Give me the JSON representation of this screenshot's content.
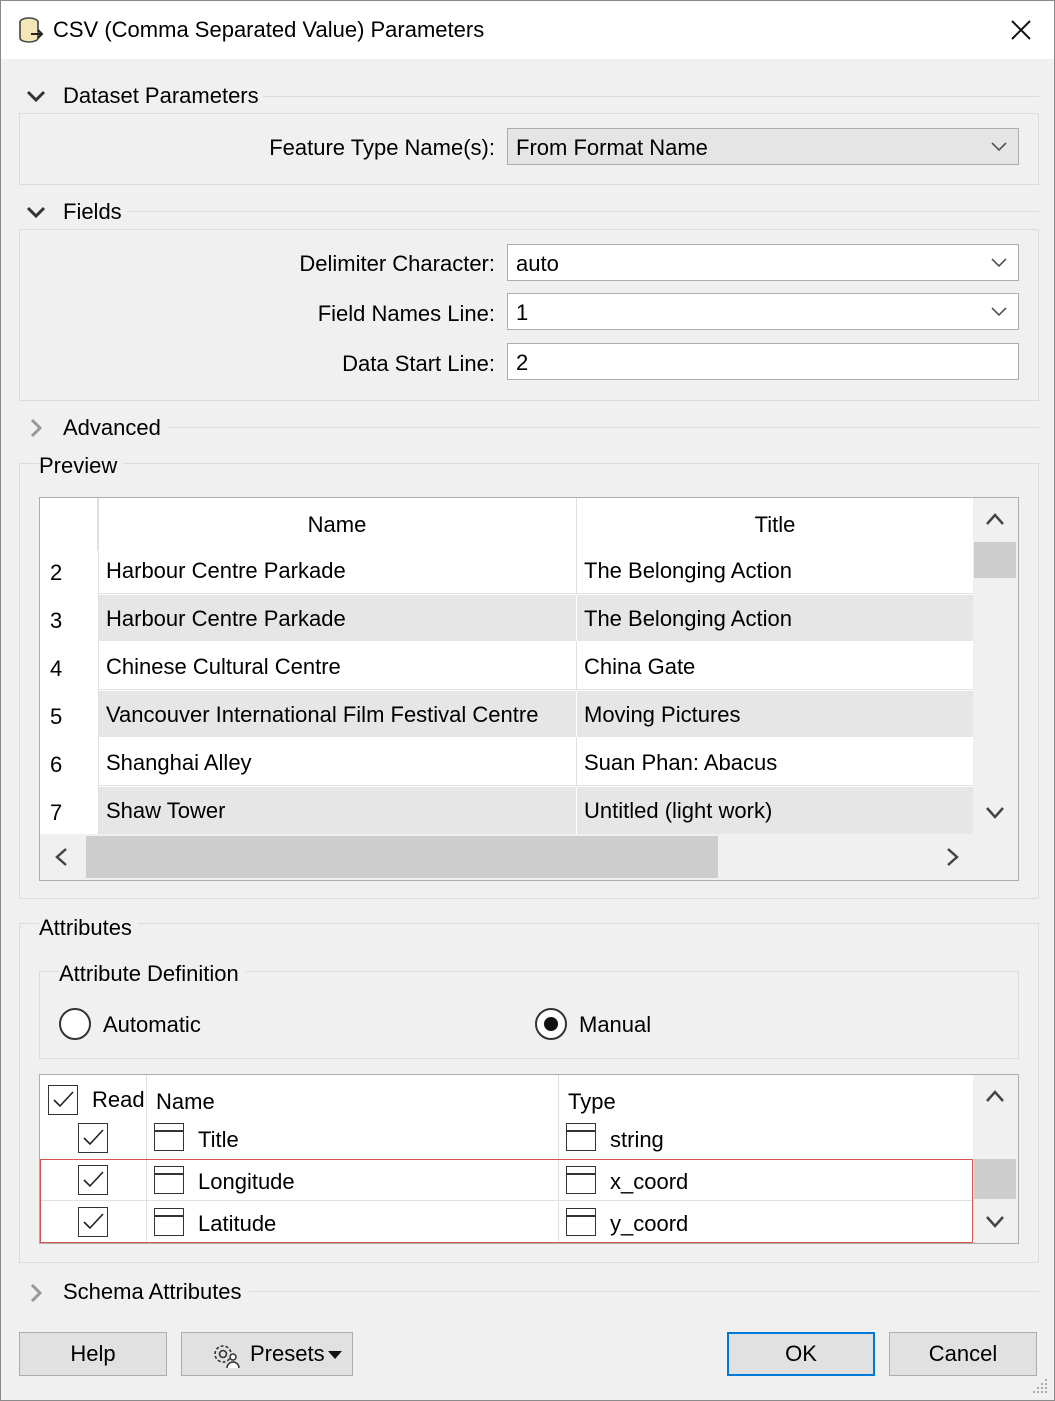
{
  "window": {
    "title": "CSV (Comma Separated Value) Parameters",
    "close_icon": "close-icon"
  },
  "dataset": {
    "header": "Dataset Parameters",
    "feature_type_label": "Feature Type Name(s):",
    "feature_type_value": "From Format Name"
  },
  "fields": {
    "header": "Fields",
    "delimiter_label": "Delimiter Character:",
    "delimiter_value": "auto",
    "field_names_label": "Field Names Line:",
    "field_names_value": "1",
    "data_start_label": "Data Start Line:",
    "data_start_value": "2"
  },
  "advanced": {
    "header": "Advanced"
  },
  "preview": {
    "header": "Preview",
    "columns": [
      "Name",
      "Title"
    ],
    "rows": [
      {
        "num": "2",
        "name": "Harbour Centre Parkade",
        "title": "The Belonging Action"
      },
      {
        "num": "3",
        "name": "Harbour Centre Parkade",
        "title": "The Belonging Action"
      },
      {
        "num": "4",
        "name": "Chinese Cultural Centre",
        "title": "China Gate"
      },
      {
        "num": "5",
        "name": "Vancouver International Film Festival Centre",
        "title": "Moving Pictures"
      },
      {
        "num": "6",
        "name": "Shanghai Alley",
        "title": "Suan Phan: Abacus"
      },
      {
        "num": "7",
        "name": "Shaw Tower",
        "title": "Untitled (light work)"
      }
    ]
  },
  "attributes": {
    "header": "Attributes",
    "definition_header": "Attribute Definition",
    "option_automatic": "Automatic",
    "option_manual": "Manual",
    "selected": "Manual",
    "columns": [
      "Read",
      "Name",
      "Type"
    ],
    "rows": [
      {
        "read": true,
        "name": "Title",
        "type": "string"
      },
      {
        "read": true,
        "name": "Longitude",
        "type": "x_coord"
      },
      {
        "read": true,
        "name": "Latitude",
        "type": "y_coord"
      }
    ],
    "highlight_color": "#d9534f"
  },
  "schema": {
    "header": "Schema Attributes"
  },
  "buttons": {
    "help": "Help",
    "presets": "Presets",
    "ok": "OK",
    "cancel": "Cancel"
  },
  "colors": {
    "accent": "#0078d7",
    "row_alt": "#e6e6e6",
    "scroll_thumb": "#cdcdcd"
  }
}
